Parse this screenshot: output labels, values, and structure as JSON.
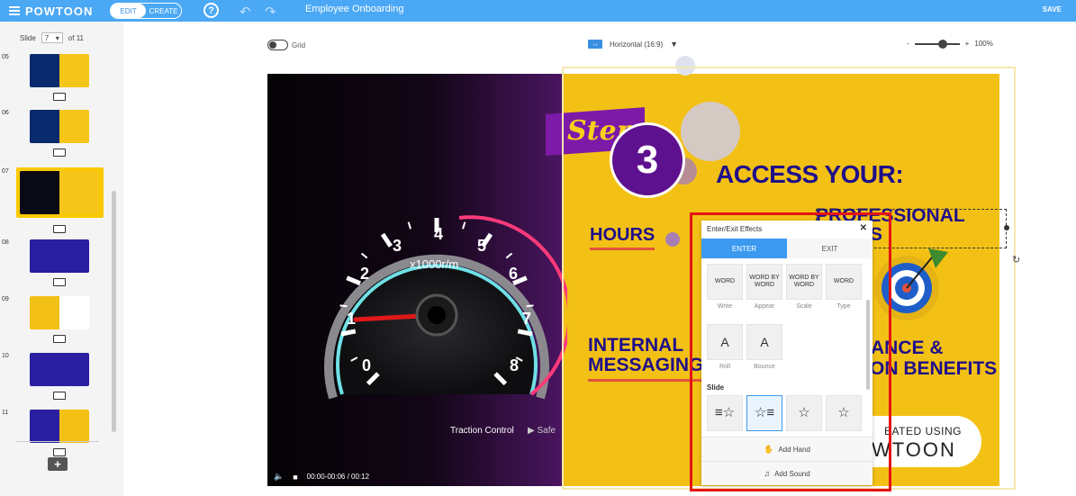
{
  "app": {
    "logo_text": "POWTOON",
    "mode_edit": "EDIT",
    "mode_create": "CREATE",
    "help": "?",
    "doc_title": "Employee Onboarding",
    "save_label": "SAVE"
  },
  "sidebar": {
    "slide_label": "Slide",
    "current_slide": "7",
    "total_label": "of 11",
    "slides": [
      {
        "num": "05",
        "colors": [
          "#0a2a6e",
          "#f5c51a"
        ]
      },
      {
        "num": "06",
        "colors": [
          "#0a2a6e",
          "#f5c51a"
        ]
      },
      {
        "num": "07",
        "colors": [
          "#0a0a14",
          "#f5c51a"
        ],
        "active": true
      },
      {
        "num": "08",
        "colors": [
          "#2a1fa0",
          "#2a1fa0"
        ]
      },
      {
        "num": "09",
        "colors": [
          "#f3c115",
          "#ffffff"
        ]
      },
      {
        "num": "10",
        "colors": [
          "#2a1fa0",
          "#2a1fa0"
        ]
      },
      {
        "num": "11",
        "colors": [
          "#2a1fa0",
          "#f3c115"
        ]
      }
    ]
  },
  "toolbar": {
    "grid_label": "Grid",
    "aspect_label": "Horizontal (16:9)",
    "zoom_percent": "100%",
    "zoom_minus": "-",
    "zoom_plus": "+"
  },
  "slide": {
    "step_word": "Step",
    "step_number": "3",
    "heading_access": "ACCESS YOUR:",
    "hours": "HOURS",
    "professional": "PROFESSIONAL",
    "professional_2": "S",
    "internal_1": "INTERNAL",
    "internal_2": "MESSAGING",
    "balance_1": "ANCE &",
    "balance_2": "ON BENEFITS",
    "created_1": "EATED USING",
    "created_2": "WTOON",
    "gauge_unit": "x1000r/m",
    "gauge_ticks": [
      "0",
      "1",
      "2",
      "3",
      "4",
      "5",
      "6",
      "7",
      "8"
    ],
    "traction": "Traction Control",
    "safe": "▶ Safe",
    "time": "00:00-00:06 / 00:12"
  },
  "effects_panel": {
    "title": "Enter/Exit Effects",
    "tab_enter": "ENTER",
    "tab_exit": "EXIT",
    "effects": [
      {
        "label": "Write",
        "icon": "hand-write-icon",
        "preview": "WORD"
      },
      {
        "label": "Appear",
        "icon": "appear-icon",
        "preview": "WORD BY WORD"
      },
      {
        "label": "Scale",
        "icon": "scale-icon",
        "preview": "WORD BY WORD"
      },
      {
        "label": "Type",
        "icon": "type-icon",
        "preview": "WORD"
      },
      {
        "label": "Roll",
        "icon": "roll-icon",
        "preview": "A"
      },
      {
        "label": "Bounce",
        "icon": "bounce-icon",
        "preview": "A"
      }
    ],
    "section_slide": "Slide",
    "add_hand": "Add Hand",
    "add_sound": "Add Sound"
  }
}
